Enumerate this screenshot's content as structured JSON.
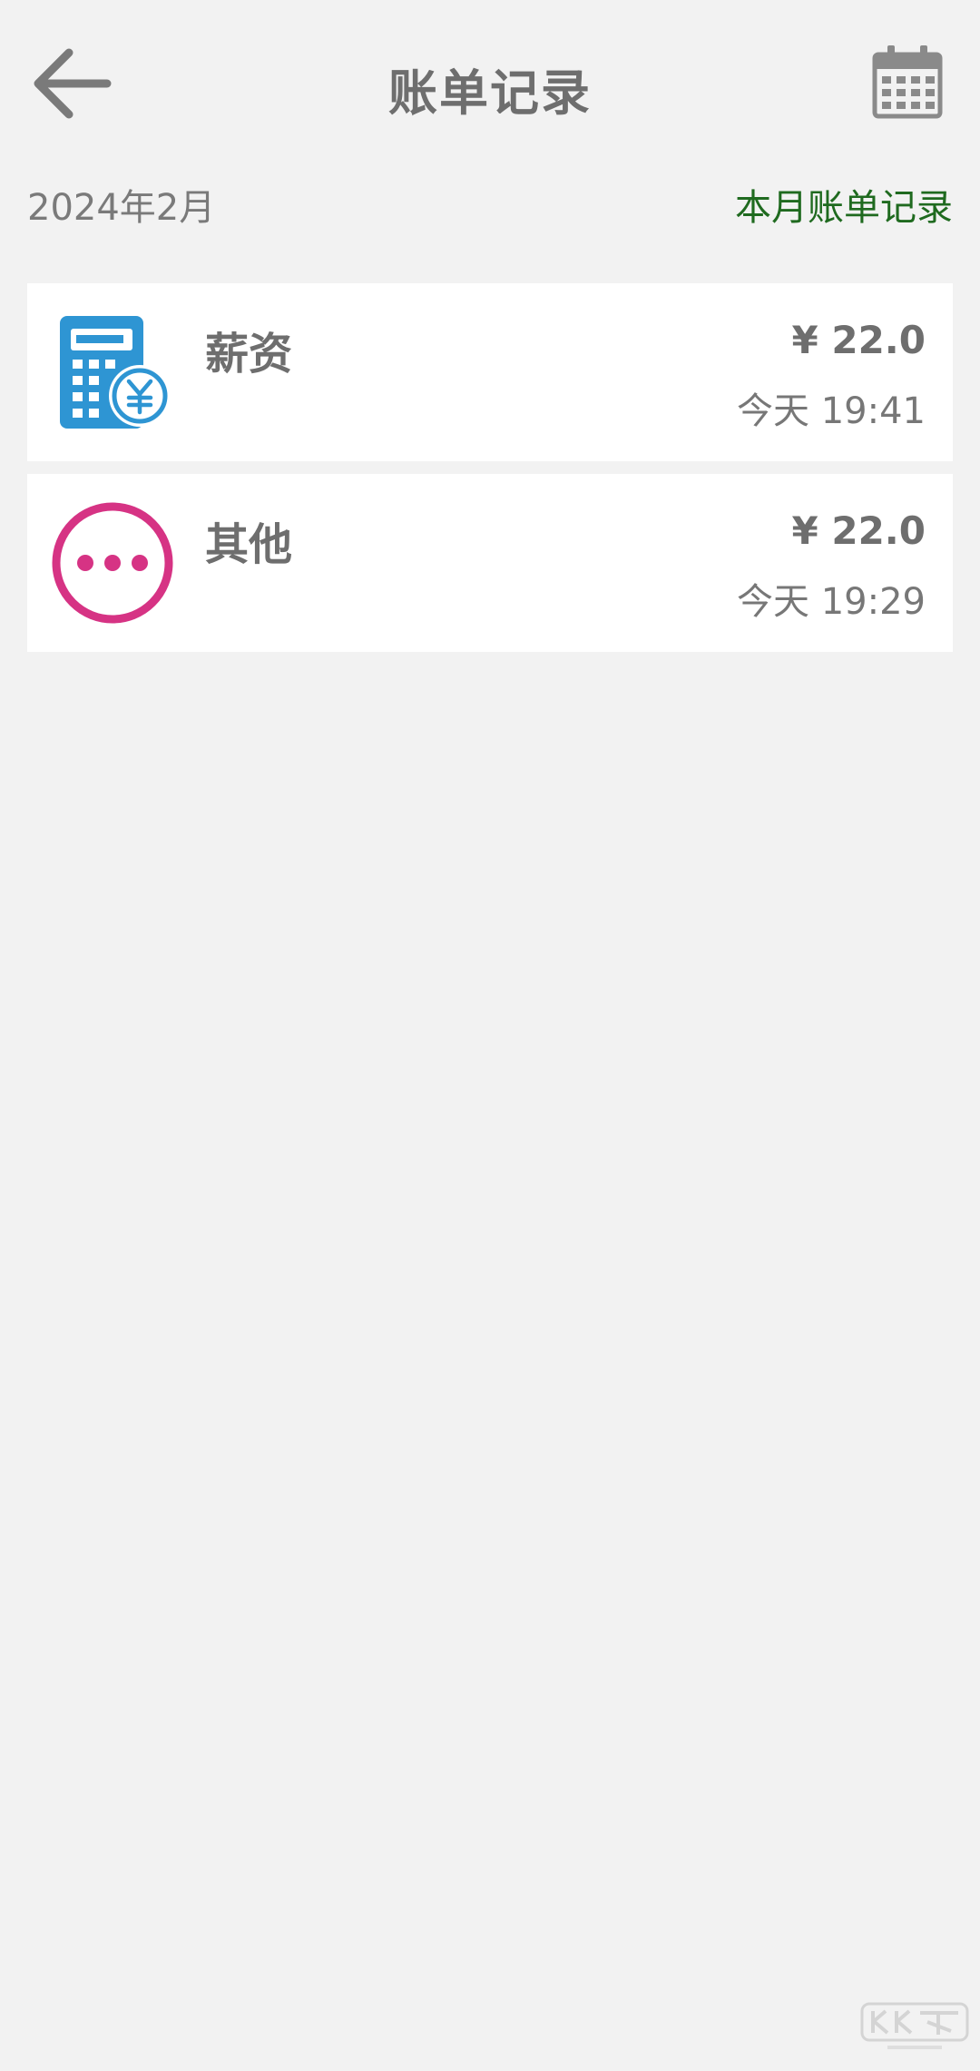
{
  "header": {
    "title": "账单记录",
    "back_icon": "arrow-left-icon",
    "calendar_icon": "calendar-icon"
  },
  "subheader": {
    "month": "2024年2月",
    "link": "本月账单记录",
    "link_color": "#1f6a1f"
  },
  "records": [
    {
      "name": "薪资",
      "amount": "¥ 22.0",
      "time": "今天 19:41",
      "icon": "salary-calculator-icon",
      "icon_color": "#2e95d3"
    },
    {
      "name": "其他",
      "amount": "¥ 22.0",
      "time": "今天 19:29",
      "icon": "more-dots-icon",
      "icon_color": "#d63384"
    }
  ],
  "watermark": {
    "icon": "kkx-watermark-logo"
  },
  "colors": {
    "background": "#f2f2f2",
    "card": "#ffffff",
    "text_primary": "#6e6e6e"
  }
}
